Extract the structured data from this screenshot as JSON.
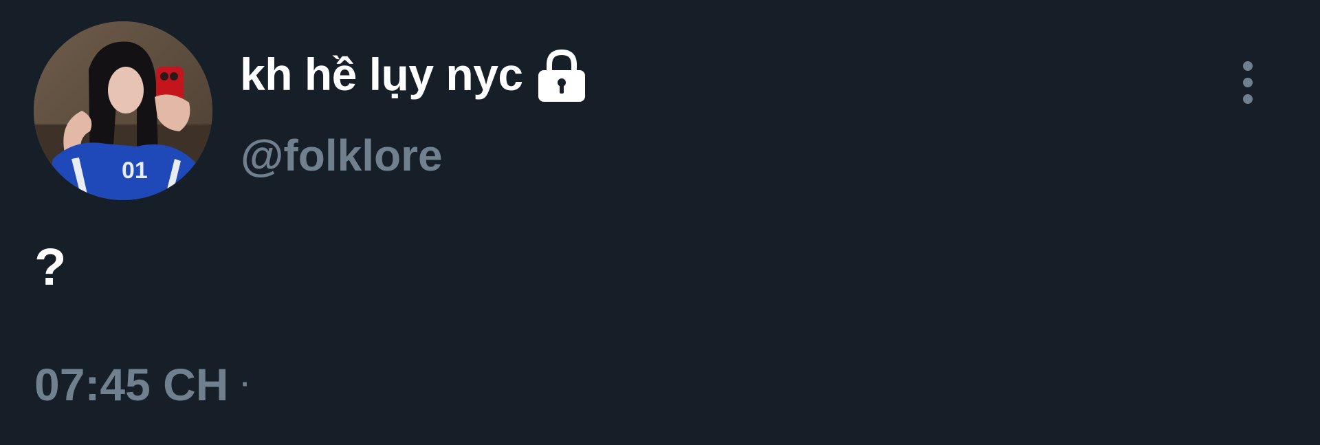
{
  "tweet": {
    "display_name": "kh hề lụy nyc",
    "handle": "@folklore",
    "text": "?",
    "time": "07:45 CH",
    "separator": "·",
    "protected_icon": "lock-icon",
    "menu_icon": "more-vertical-icon"
  },
  "colors": {
    "background": "#161e28",
    "primary_text": "#ffffff",
    "secondary_text": "#71808f"
  }
}
